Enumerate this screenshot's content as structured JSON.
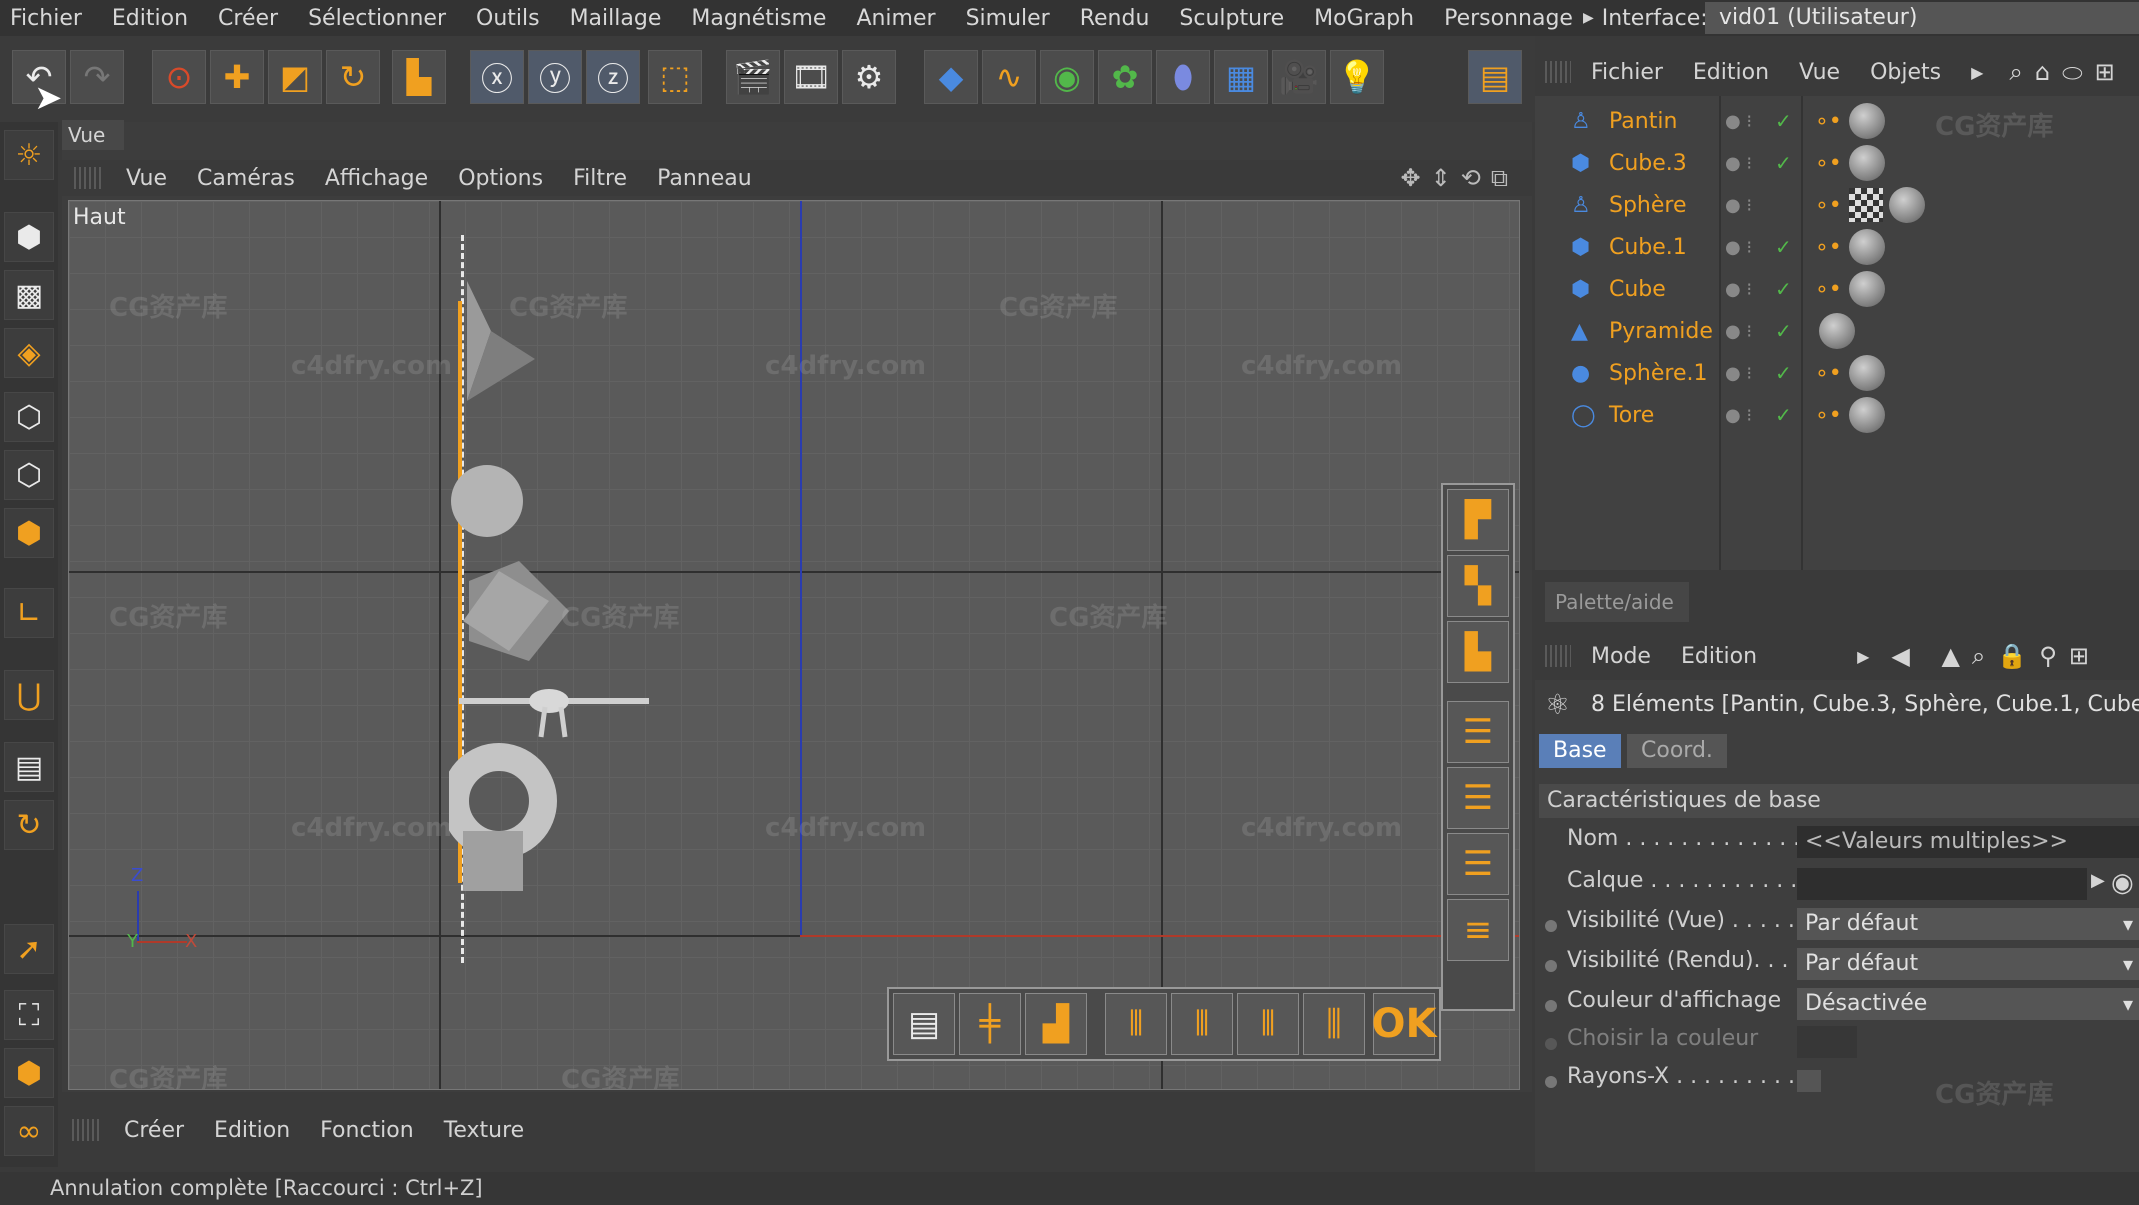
{
  "menubar": {
    "items": [
      "Fichier",
      "Edition",
      "Créer",
      "Sélectionner",
      "Outils",
      "Maillage",
      "Magnétisme",
      "Animer",
      "Simuler",
      "Rendu",
      "Sculpture",
      "MoGraph",
      "Personnage"
    ],
    "interface_label": "Interface:",
    "layout_value": "vid01 (Utilisateur)"
  },
  "viewport": {
    "tab_label": "Vue",
    "menu": [
      "Vue",
      "Caméras",
      "Affichage",
      "Options",
      "Filtre",
      "Panneau"
    ],
    "view_name": "Haut",
    "axis_x": "X",
    "axis_y": "Y",
    "axis_z": "Z",
    "ok_label": "OK"
  },
  "watermarks": {
    "site": "c4dfry.com",
    "brand": "CG资产库"
  },
  "object_manager": {
    "menu": [
      "Fichier",
      "Edition",
      "Vue",
      "Objets"
    ],
    "objects": [
      {
        "name": "Pantin",
        "icon": "figure-icon"
      },
      {
        "name": "Cube.3",
        "icon": "cube-icon"
      },
      {
        "name": "Sphère",
        "icon": "figure-icon"
      },
      {
        "name": "Cube.1",
        "icon": "cube-icon"
      },
      {
        "name": "Cube",
        "icon": "cube-icon"
      },
      {
        "name": "Pyramide",
        "icon": "pyramid-icon"
      },
      {
        "name": "Sphère.1",
        "icon": "sphere-icon"
      },
      {
        "name": "Tore",
        "icon": "torus-icon"
      }
    ],
    "palette_tab": "Palette/aide"
  },
  "attributes": {
    "menu": [
      "Mode",
      "Edition"
    ],
    "title": "8 Eléments [Pantin, Cube.3, Sphère, Cube.1, Cube,",
    "tabs": [
      "Base",
      "Coord."
    ],
    "section": "Caractéristiques de base",
    "rows": [
      {
        "label": "Nom . . . . . . . . . . . . . .",
        "value": "<<Valeurs multiples>>"
      },
      {
        "label": "Calque . . . . . . . . . . . .",
        "value": ""
      },
      {
        "label": "Visibilité (Vue) . . . . .",
        "value": "Par défaut"
      },
      {
        "label": "Visibilité (Rendu). . .",
        "value": "Par défaut"
      },
      {
        "label": "Couleur d'affichage",
        "value": "Désactivée"
      },
      {
        "label": "Choisir la couleur",
        "value": ""
      },
      {
        "label": "Rayons-X . . . . . . . . . .",
        "value": ""
      }
    ]
  },
  "material_menu": [
    "Créer",
    "Edition",
    "Fonction",
    "Texture"
  ],
  "status": "Annulation complète [Raccourci : Ctrl+Z]",
  "colors": {
    "accent_orange": "#f0a020",
    "selection_blue": "#5a7fb8"
  }
}
